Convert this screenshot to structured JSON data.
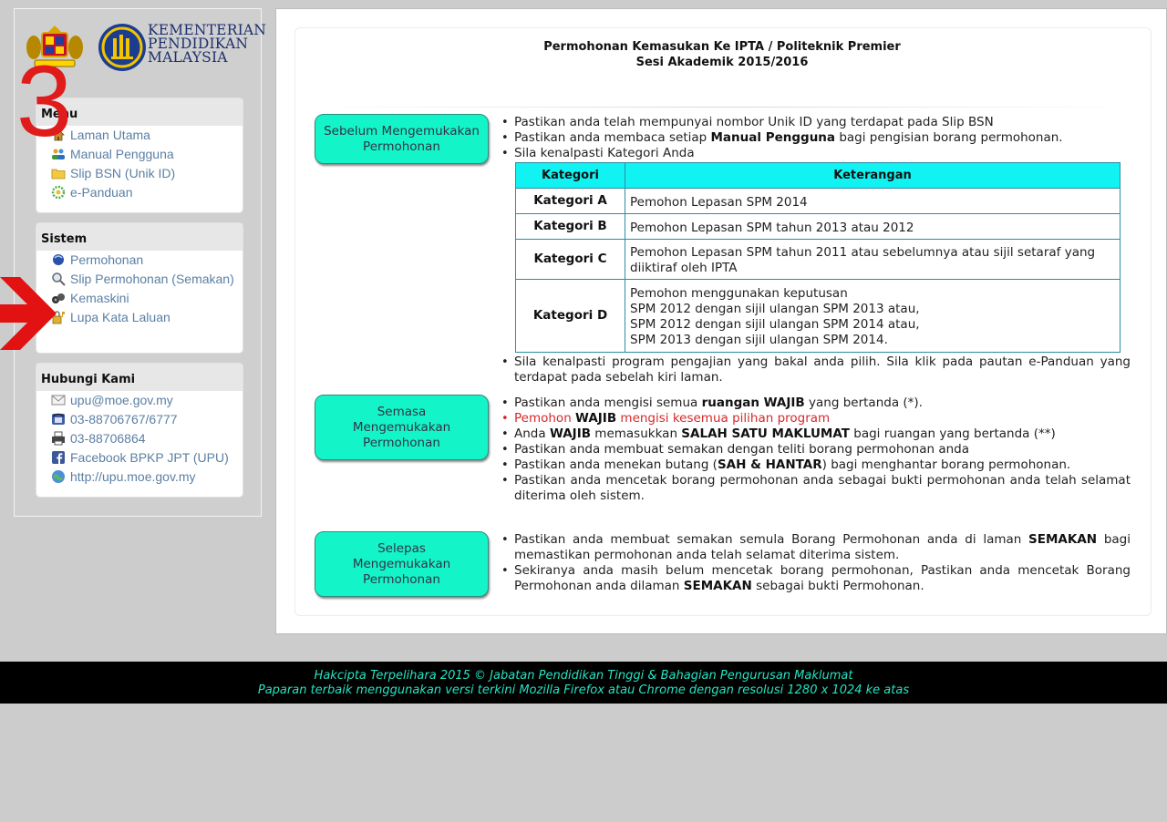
{
  "logo": {
    "line1": "KEMENTERIAN",
    "line2": "PENDIDIKAN",
    "line3": "MALAYSIA"
  },
  "overlay": {
    "step_number": "3"
  },
  "menu": {
    "title": "Menu",
    "items": [
      {
        "label": "Laman Utama",
        "icon": "home-icon"
      },
      {
        "label": "Manual Pengguna",
        "icon": "users-icon"
      },
      {
        "label": "Slip BSN (Unik ID)",
        "icon": "folder-icon"
      },
      {
        "label": "e-Panduan",
        "icon": "gear-icon"
      }
    ]
  },
  "sistem": {
    "title": "Sistem",
    "items": [
      {
        "label": "Permohonan",
        "icon": "form-icon"
      },
      {
        "label": "Slip Permohonan (Semakan)",
        "icon": "magnifier-icon"
      },
      {
        "label": "Kemaskini",
        "icon": "binoculars-icon"
      },
      {
        "label": "Lupa Kata Laluan",
        "icon": "lock-icon"
      }
    ]
  },
  "hubungi": {
    "title": "Hubungi Kami",
    "items": [
      {
        "label": "upu@moe.gov.my",
        "icon": "mail-icon"
      },
      {
        "label": "03-88706767/6777",
        "icon": "phone-icon"
      },
      {
        "label": "03-88706864",
        "icon": "fax-icon"
      },
      {
        "label": "Facebook BPKP JPT (UPU)",
        "icon": "facebook-icon"
      },
      {
        "label": "http://upu.moe.gov.my",
        "icon": "globe-icon"
      }
    ]
  },
  "main": {
    "title_line1": "Permohonan Kemasukan Ke IPTA / Politeknik Premier",
    "title_line2": "Sesi Akademik 2015/2016",
    "stage1": {
      "label": "Sebelum Mengemukakan Permohonan",
      "b1": "Pastikan anda telah mempunyai nombor Unik ID yang terdapat pada Slip BSN",
      "b2_pre": "Pastikan anda membaca setiap ",
      "b2_bold": "Manual Pengguna",
      "b2_post": " bagi pengisian borang permohonan.",
      "b3": "Sila kenalpasti Kategori Anda",
      "b4": "Sila kenalpasti program pengajian yang bakal anda pilih. Sila klik pada pautan e-Panduan yang terdapat pada sebelah kiri laman."
    },
    "table": {
      "col1": "Kategori",
      "col2": "Keterangan",
      "rows": [
        {
          "cat": "Kategori A",
          "desc": [
            "Pemohon Lepasan SPM 2014"
          ]
        },
        {
          "cat": "Kategori B",
          "desc": [
            "Pemohon Lepasan SPM tahun 2013 atau 2012"
          ]
        },
        {
          "cat": "Kategori C",
          "desc": [
            "Pemohon Lepasan SPM tahun 2011 atau sebelumnya atau sijil setaraf yang diiktiraf oleh IPTA"
          ]
        },
        {
          "cat": "Kategori D",
          "desc": [
            "Pemohon menggunakan keputusan",
            "SPM 2012 dengan sijil ulangan SPM 2013 atau,",
            "SPM 2012 dengan sijil ulangan SPM 2014 atau,",
            "SPM 2013 dengan sijil ulangan SPM 2014."
          ]
        }
      ]
    },
    "stage2": {
      "label": "Semasa Mengemukakan Permohonan",
      "b1_pre": "Pastikan anda mengisi semua ",
      "b1_bold": "ruangan WAJIB",
      "b1_post": " yang bertanda (*).",
      "b2_pre": "Pemohon ",
      "b2_bold": "WAJIB",
      "b2_post": " mengisi kesemua pilihan program",
      "b3_pre": "Anda ",
      "b3_bold1": "WAJIB",
      "b3_mid": " memasukkan ",
      "b3_bold2": "SALAH SATU MAKLUMAT",
      "b3_post": " bagi ruangan yang bertanda (**)",
      "b4": "Pastikan anda membuat semakan dengan teliti borang permohonan anda",
      "b5_pre": "Pastikan anda menekan butang (",
      "b5_bold": "SAH & HANTAR",
      "b5_post": ") bagi menghantar borang permohonan.",
      "b6": "Pastikan anda mencetak borang permohonan anda sebagai bukti permohonan anda telah selamat diterima oleh sistem."
    },
    "stage3": {
      "label": "Selepas Mengemukakan Permohonan",
      "b1_pre": "Pastikan anda membuat semakan semula Borang Permohonan anda di laman ",
      "b1_bold": "SEMAKAN",
      "b1_post": " bagi memastikan permohonan anda telah selamat diterima sistem.",
      "b2_pre": "Sekiranya anda masih belum mencetak borang permohonan, Pastikan anda mencetak Borang Permohonan anda dilaman ",
      "b2_bold": "SEMAKAN",
      "b2_post": " sebagai bukti Permohonan."
    }
  },
  "footer": {
    "line1": "Hakcipta Terpelihara 2015 © Jabatan Pendidikan Tinggi & Bahagian Pengurusan Maklumat",
    "line2": "Paparan terbaik menggunakan versi terkini Mozilla Firefox atau Chrome dengan resolusi 1280 x 1024 ke atas"
  },
  "colors": {
    "stage_bg": "#13f5c8",
    "table_header": "#11f2f3",
    "footer_text": "#27e3c1",
    "link": "#5b7fa3",
    "overlay_red": "#e01b1b"
  }
}
